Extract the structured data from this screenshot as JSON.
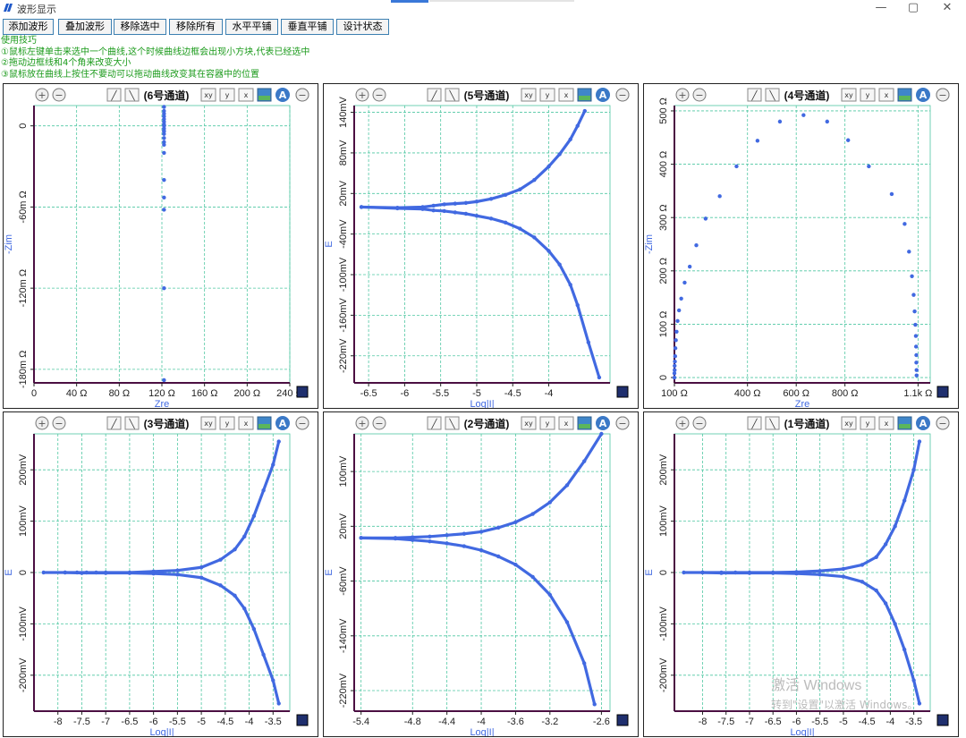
{
  "window": {
    "title": "波形显示",
    "controls": [
      "—",
      "▢",
      "✕"
    ]
  },
  "toolbar": {
    "buttons": [
      "添加波形",
      "叠加波形",
      "移除选中",
      "移除所有",
      "水平平铺",
      "垂直平铺",
      "设计状态"
    ]
  },
  "tips": {
    "heading": "使用技巧",
    "lines": [
      "①鼠标左键单击来选中一个曲线,这个时候曲线边框会出现小方块,代表已经选中",
      "②拖动边框线和4个角来改变大小",
      "③鼠标放在曲线上按住不要动可以拖动曲线改变其在容器中的位置"
    ]
  },
  "watermark": {
    "line1": "激活 Windows",
    "line2": "转到\"设置\"以激活 Windows。"
  },
  "colors": {
    "series": "#4169e1",
    "grid": "#4fc7a2",
    "axis": "#4b0f42",
    "button_border": "#3c7fb1",
    "tips": "#1a9a1a"
  },
  "icons": [
    "zoom-in-icon",
    "zoom-out-icon",
    "line-tool-icon",
    "curve-tool-icon",
    "fit-xy-icon",
    "fit-y-icon",
    "fit-x-icon",
    "image-icon",
    "auto-scale-icon",
    "color-swatch-icon"
  ],
  "chart_data": [
    {
      "title": "(6号通道)",
      "type": "scatter",
      "xlabel": "Zre",
      "ylabel": "-Zim",
      "xlim": [
        0,
        240
      ],
      "ylim": [
        -190,
        15
      ],
      "xticks": [
        "0",
        "40 Ω",
        "80 Ω",
        "120 Ω",
        "160 Ω",
        "200 Ω",
        "240 Ω"
      ],
      "yticks": [
        "0",
        "-60m Ω",
        "-120m Ω",
        "-180m Ω"
      ],
      "series": [
        {
          "x": [
            122,
            122,
            122,
            122,
            122,
            122,
            122,
            122,
            122,
            122,
            122,
            122,
            122,
            122,
            122,
            122,
            122,
            122,
            122,
            122,
            122
          ],
          "y": [
            14,
            11,
            9,
            7,
            5,
            3,
            1,
            0,
            -2,
            -4,
            -6,
            -9,
            -12,
            -14,
            -20,
            -40,
            -53,
            -62,
            -120,
            -188,
            -4
          ]
        }
      ]
    },
    {
      "title": "(5号通道)",
      "type": "line",
      "xlabel": "Log|I|",
      "ylabel": "E",
      "xlim": [
        -6.7,
        -3.15
      ],
      "ylim": [
        -260,
        150
      ],
      "xticks": [
        "-6.5",
        "-6",
        "-5.5",
        "-5",
        "-4.5",
        "-4"
      ],
      "yticks": [
        "140mV",
        "80mV",
        "20mV",
        "-40mV",
        "-100mV",
        "-160mV",
        "-220mV"
      ],
      "series": [
        {
          "x": [
            -6.6,
            -6.1,
            -5.75,
            -5.6,
            -5.45,
            -5.3,
            -5.15,
            -5.0,
            -4.8,
            -4.6,
            -4.4,
            -4.2,
            -4.0,
            -3.85,
            -3.7,
            -3.6,
            -3.5
          ],
          "y": [
            0,
            -1,
            0,
            2,
            4,
            5,
            6,
            8,
            12,
            18,
            26,
            40,
            60,
            78,
            100,
            120,
            142
          ]
        },
        {
          "x": [
            -6.6,
            -6.1,
            -5.75,
            -5.6,
            -5.45,
            -5.3,
            -5.15,
            -5.0,
            -4.8,
            -4.6,
            -4.4,
            -4.2,
            -4.0,
            -3.85,
            -3.7,
            -3.6,
            -3.45,
            -3.3
          ],
          "y": [
            0,
            -2,
            -3,
            -5,
            -6,
            -8,
            -10,
            -13,
            -17,
            -23,
            -32,
            -45,
            -65,
            -85,
            -115,
            -145,
            -200,
            -252
          ]
        }
      ]
    },
    {
      "title": "(4号通道)",
      "type": "scatter",
      "xlabel": "Zre",
      "ylabel": "-Zim",
      "xlim": [
        100,
        1150
      ],
      "ylim": [
        -10,
        510
      ],
      "xticks": [
        "100 Ω",
        "400 Ω",
        "600 Ω",
        "800 Ω",
        "1.1k Ω"
      ],
      "yticks": [
        "0",
        "100 Ω",
        "200 Ω",
        "300 Ω",
        "400 Ω",
        "500 Ω"
      ],
      "series": [
        {
          "x": [
            100,
            100,
            101,
            101,
            102,
            103,
            104,
            106,
            109,
            113,
            119,
            128,
            142,
            163,
            190,
            228,
            286,
            355,
            441,
            533,
            630,
            727,
            813,
            898,
            992,
            1045,
            1063,
            1075,
            1082,
            1086,
            1089,
            1091,
            1092,
            1093,
            1093,
            1094,
            1094
          ],
          "y": [
            0,
            8,
            14,
            22,
            30,
            40,
            55,
            70,
            86,
            106,
            126,
            148,
            178,
            208,
            248,
            298,
            340,
            396,
            444,
            480,
            492,
            480,
            445,
            396,
            344,
            288,
            236,
            190,
            155,
            124,
            99,
            78,
            58,
            42,
            28,
            14,
            4
          ]
        }
      ]
    },
    {
      "title": "(3号通道)",
      "type": "line",
      "xlabel": "Log|I|",
      "ylabel": "E",
      "xlim": [
        -8.5,
        -3.15
      ],
      "ylim": [
        -270,
        270
      ],
      "xticks": [
        "-8",
        "-7.5",
        "-7",
        "-6.5",
        "-6",
        "-5.5",
        "-5",
        "-4.5",
        "-4",
        "-3.5"
      ],
      "yticks": [
        "200mV",
        "100mV",
        "0",
        "-100mV",
        "-200mV"
      ],
      "series": [
        {
          "x": [
            -8.3,
            -7.85,
            -7.6,
            -7.4,
            -7.2,
            -7.0,
            -6.5,
            -6.0,
            -5.5,
            -5.0,
            -4.6,
            -4.3,
            -4.1,
            -3.9,
            -3.7,
            -3.5,
            -3.38
          ],
          "y": [
            0,
            0,
            0,
            0,
            0,
            0,
            0,
            2,
            4,
            10,
            25,
            45,
            70,
            110,
            160,
            210,
            255
          ]
        },
        {
          "x": [
            -7.85,
            -7.5,
            -7.0,
            -6.5,
            -6.0,
            -5.5,
            -5.0,
            -4.6,
            -4.3,
            -4.1,
            -3.9,
            -3.7,
            -3.5,
            -3.38
          ],
          "y": [
            0,
            -1,
            -1,
            -1,
            -2,
            -4,
            -10,
            -25,
            -45,
            -70,
            -110,
            -160,
            -210,
            -255
          ]
        }
      ]
    },
    {
      "title": "(2号通道)",
      "type": "line",
      "xlabel": "Log|I|",
      "ylabel": "E",
      "xlim": [
        -5.48,
        -2.5
      ],
      "ylim": [
        -250,
        155
      ],
      "xticks": [
        "-5.4",
        "-4.8",
        "-4.4",
        "-4",
        "-3.6",
        "-3.2",
        "-2.6"
      ],
      "yticks": [
        "100mV",
        "20mV",
        "-60mV",
        "-140mV",
        "-220mV"
      ],
      "series": [
        {
          "x": [
            -5.4,
            -5.0,
            -4.8,
            -4.6,
            -4.4,
            -4.2,
            -4.0,
            -3.8,
            -3.6,
            -3.4,
            -3.2,
            -3.0,
            -2.8,
            -2.6
          ],
          "y": [
            3,
            3,
            4,
            5,
            7,
            9,
            12,
            18,
            26,
            38,
            55,
            80,
            115,
            155
          ]
        },
        {
          "x": [
            -5.4,
            -5.0,
            -4.8,
            -4.6,
            -4.4,
            -4.2,
            -4.0,
            -3.8,
            -3.6,
            -3.4,
            -3.2,
            -3.0,
            -2.8,
            -2.68
          ],
          "y": [
            3,
            2,
            0,
            -2,
            -5,
            -9,
            -15,
            -24,
            -36,
            -54,
            -80,
            -120,
            -180,
            -240
          ]
        }
      ]
    },
    {
      "title": "(1号通道)",
      "type": "line",
      "xlabel": "Log|I|",
      "ylabel": "E",
      "xlim": [
        -8.6,
        -3.15
      ],
      "ylim": [
        -270,
        270
      ],
      "xticks": [
        "-8",
        "-7.5",
        "-7",
        "-6.5",
        "-6",
        "-5.5",
        "-5",
        "-4.5",
        "-4",
        "-3.5"
      ],
      "yticks": [
        "200mV",
        "100mV",
        "0",
        "-100mV",
        "-200mV"
      ],
      "series": [
        {
          "x": [
            -8.4,
            -8.0,
            -7.6,
            -7.3,
            -7.0,
            -6.5,
            -6.0,
            -5.5,
            -5.0,
            -4.6,
            -4.3,
            -4.1,
            -3.9,
            -3.7,
            -3.5,
            -3.38
          ],
          "y": [
            0,
            0,
            0,
            0,
            0,
            0,
            1,
            3,
            7,
            15,
            30,
            55,
            90,
            140,
            200,
            255
          ]
        },
        {
          "x": [
            -8.0,
            -7.6,
            -7.0,
            -6.5,
            -6.0,
            -5.5,
            -5.0,
            -4.6,
            -4.3,
            -4.1,
            -3.9,
            -3.7,
            -3.5,
            -3.38
          ],
          "y": [
            0,
            -1,
            -1,
            -1,
            -2,
            -4,
            -8,
            -18,
            -35,
            -60,
            -100,
            -150,
            -210,
            -255
          ]
        }
      ]
    }
  ]
}
